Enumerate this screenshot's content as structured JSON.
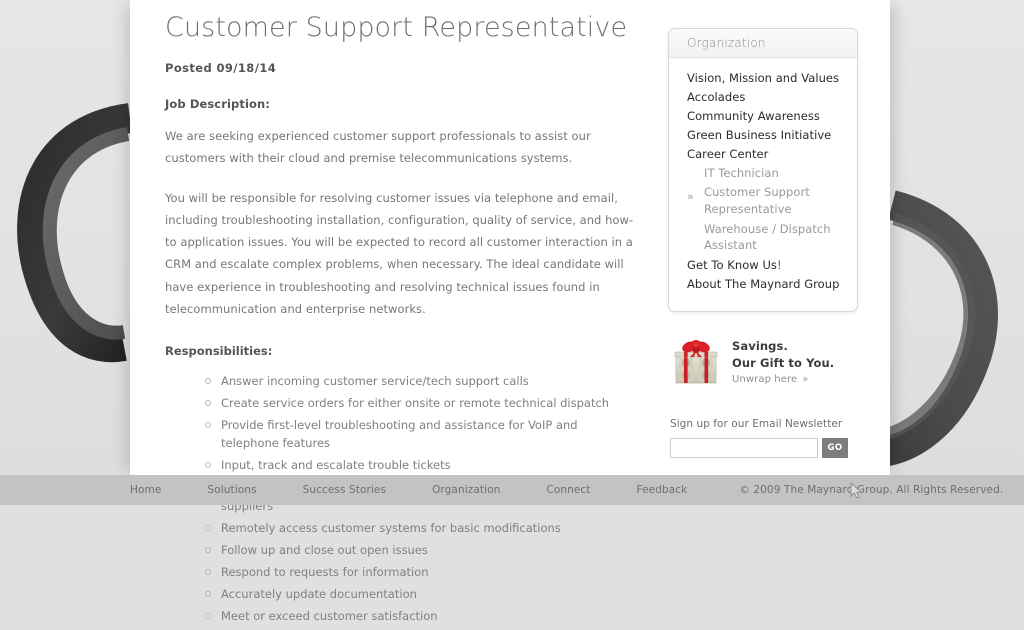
{
  "page": {
    "title": "Customer Support Representative",
    "posted": "Posted 09/18/14",
    "job_description_label": "Job Description:",
    "paragraph_1": "We are seeking experienced customer support professionals to assist our customers with their cloud and premise telecommunications systems.",
    "paragraph_2": "You will be responsible for resolving customer issues via telephone and email, including troubleshooting installation, configuration, quality of service, and how-to application issues. You will be expected to record all customer interaction in a CRM and escalate complex problems, when necessary. The ideal candidate will have experience in troubleshooting and resolving technical issues found in telecommunication and enterprise networks.",
    "responsibilities_label": "Responsibilities:",
    "responsibilities": [
      "Answer incoming customer service/tech support calls",
      "Create service orders for either onsite or remote technical dispatch",
      "Provide first-level troubleshooting and assistance for VoIP and telephone features",
      "Input, track and escalate trouble tickets",
      "Initiate contact and chase service requests with affiliate telecom suppliers",
      "Remotely access customer systems for basic modifications",
      "Follow up and close out open issues",
      "Respond to requests for information",
      "Accurately update documentation",
      "Meet or exceed customer satisfaction"
    ]
  },
  "sidebar": {
    "header": "Organization",
    "items": [
      {
        "label": "Vision, Mission and Values",
        "level": 0,
        "current": false
      },
      {
        "label": "Accolades",
        "level": 0,
        "current": false
      },
      {
        "label": "Community Awareness",
        "level": 0,
        "current": false
      },
      {
        "label": "Green Business Initiative",
        "level": 0,
        "current": false
      },
      {
        "label": "Career Center",
        "level": 0,
        "current": false
      },
      {
        "label": "IT Technician",
        "level": 1,
        "current": false
      },
      {
        "label": "Customer Support Representative",
        "level": 1,
        "current": true
      },
      {
        "label": "Warehouse / Dispatch Assistant",
        "level": 1,
        "current": false
      },
      {
        "label": "Get To Know Us!",
        "level": 0,
        "current": false
      },
      {
        "label": "About The Maynard Group",
        "level": 0,
        "current": false
      }
    ],
    "current_marker": "»"
  },
  "promo": {
    "line1": "Savings.",
    "line2": "Our Gift to You.",
    "link": "Unwrap here",
    "link_marker": "»",
    "image_alt": "money-wrapped-gift-box"
  },
  "newsletter": {
    "label": "Sign up for our Email Newsletter",
    "value": "",
    "placeholder": "",
    "button_label": "GO"
  },
  "footer": {
    "links": [
      "Home",
      "Solutions",
      "Success Stories",
      "Organization",
      "Connect",
      "Feedback"
    ],
    "copyright": "© 2009 The Maynard Group. All Rights Reserved."
  },
  "colors": {
    "page_background": "#e2e2e2",
    "sheet": "#ffffff",
    "footer_bar": "#c3c3c3",
    "title_text": "#6f6f6f",
    "body_text": "#777777",
    "nav_text": "#2b2b2b",
    "nav_sub_text": "#9a9a9a",
    "accent_red": "#c0392b",
    "go_button": "#7d7d7d"
  }
}
